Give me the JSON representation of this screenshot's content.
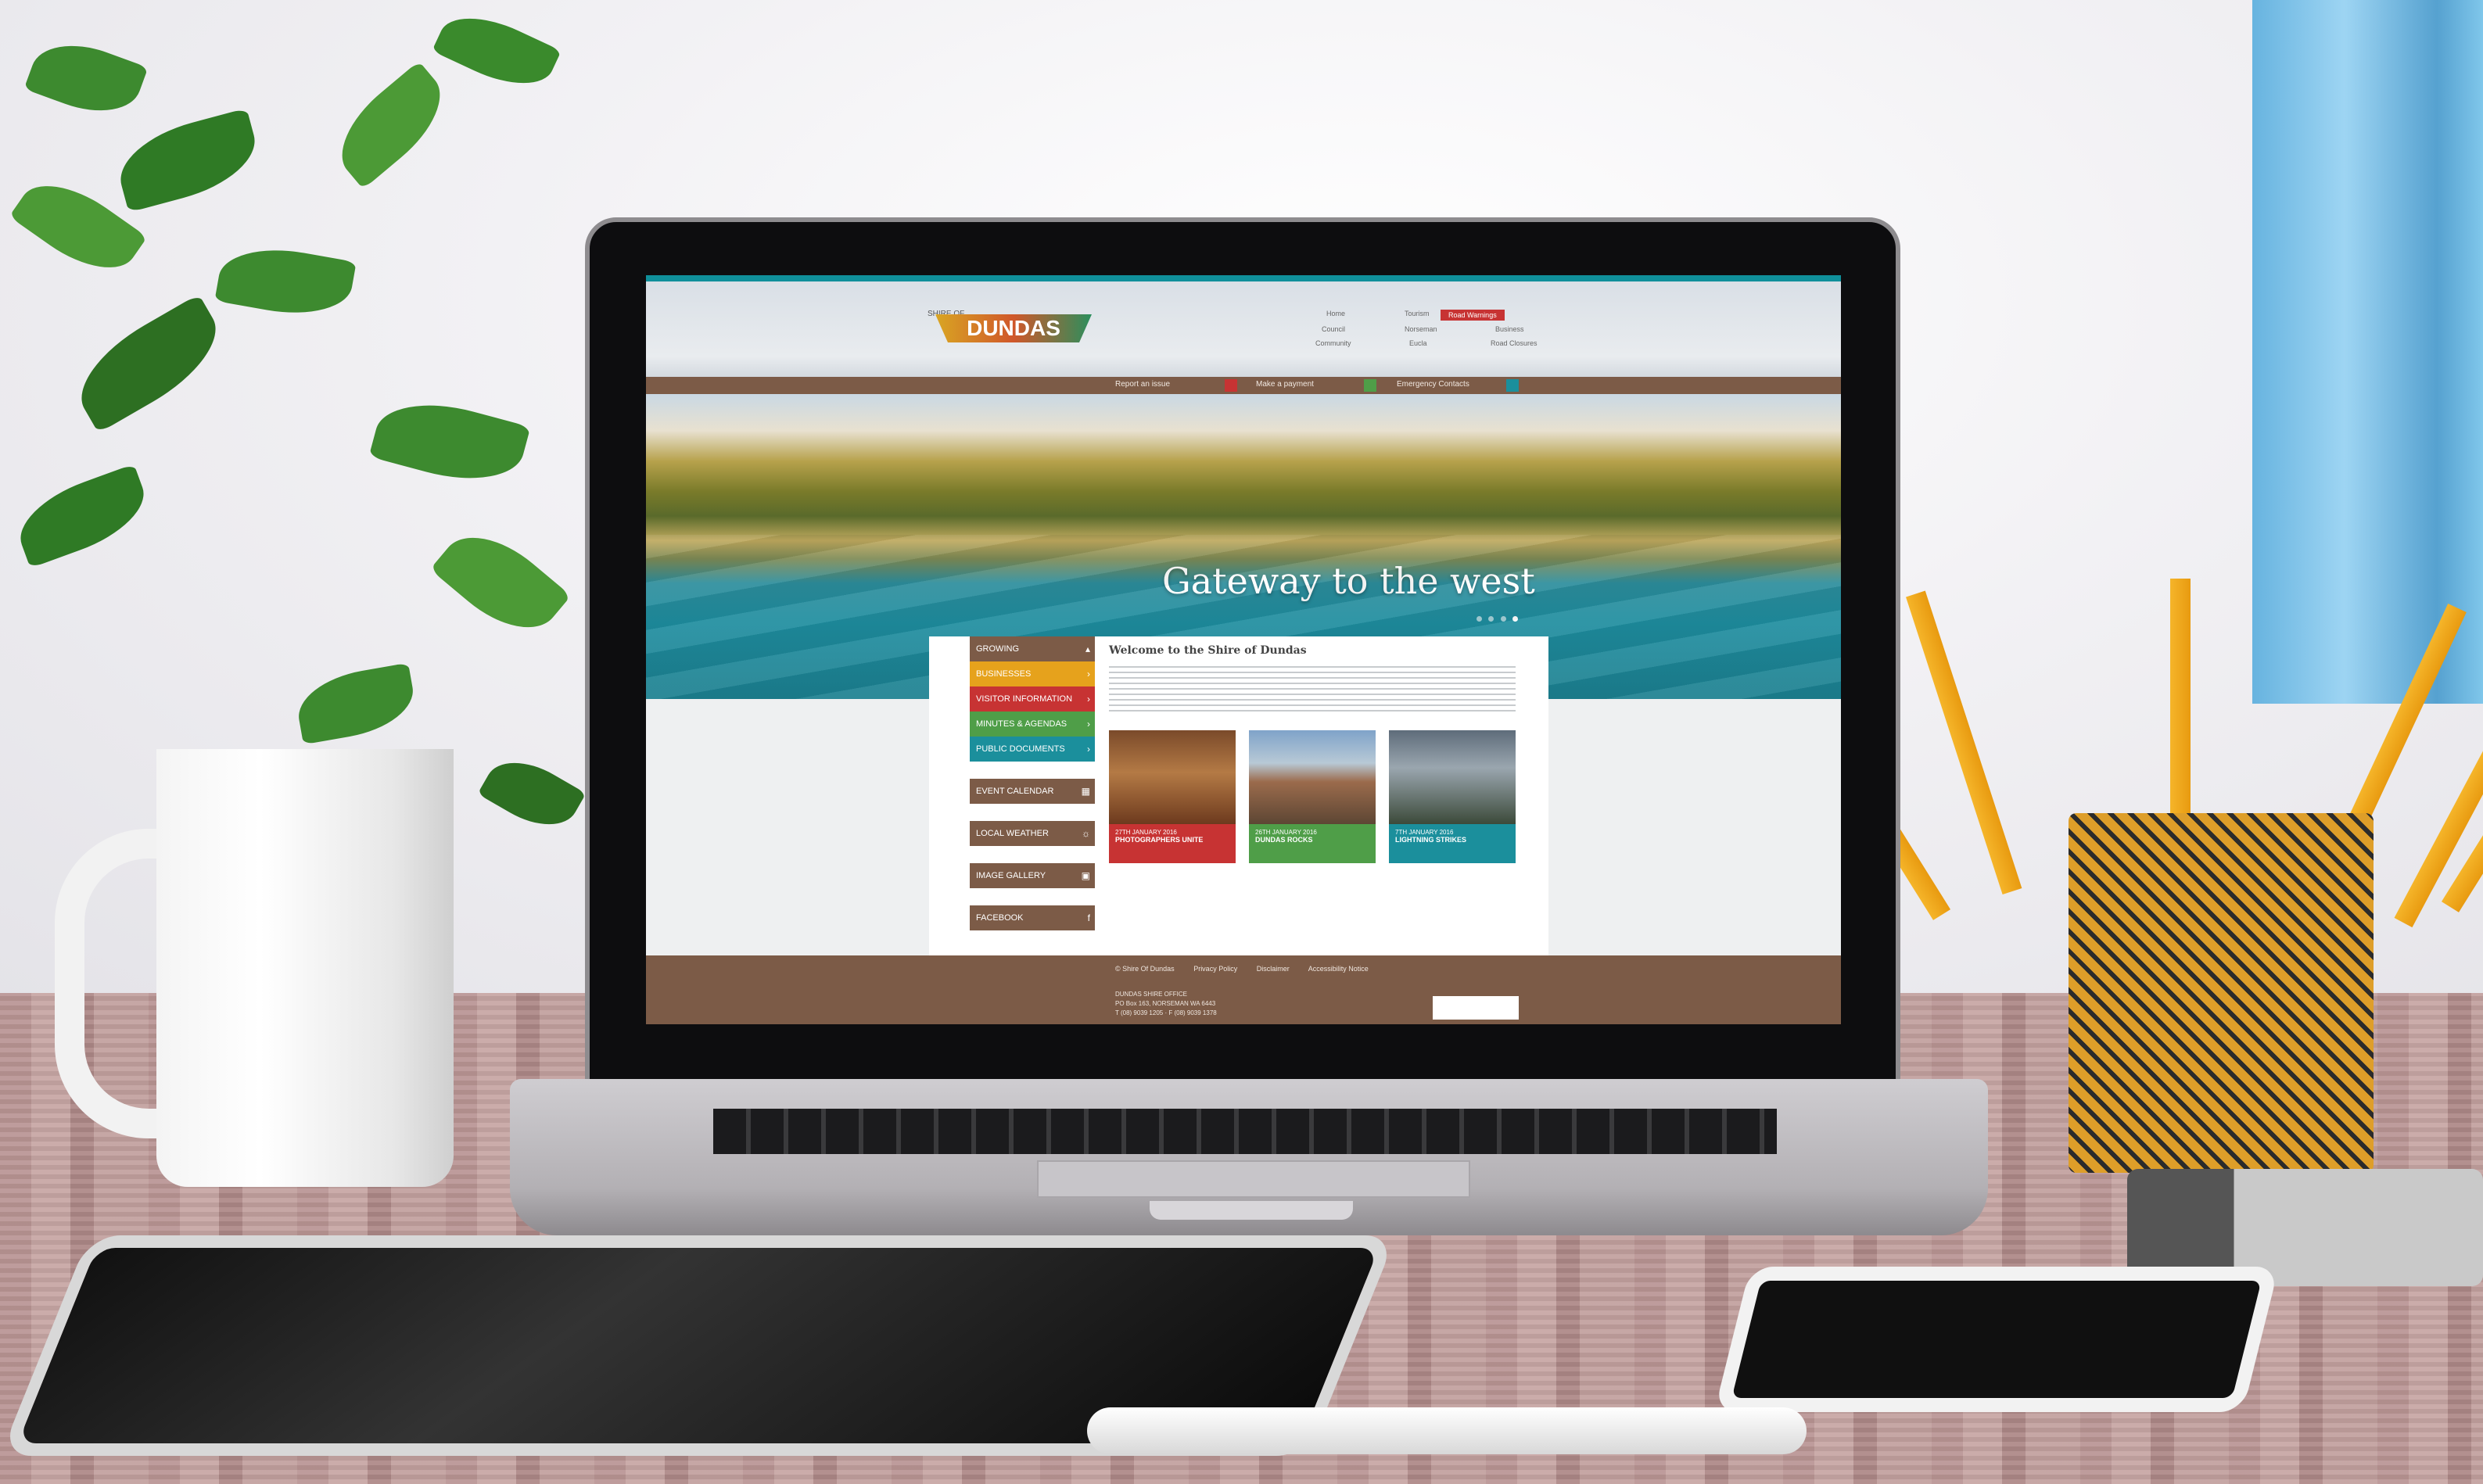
{
  "site": {
    "logo": {
      "top": "SHIRE OF",
      "name": "DUNDAS"
    },
    "topnav": [
      {
        "label": "Home"
      },
      {
        "label": "Council"
      },
      {
        "label": "Community"
      },
      {
        "label": "Tourism"
      },
      {
        "label": "Norseman"
      },
      {
        "label": "Eucla"
      },
      {
        "label": "Business"
      },
      {
        "label": "Road Closures"
      }
    ],
    "red_button": "Road Warnings",
    "subbar": [
      {
        "label": "Report an issue"
      },
      {
        "label": "Make a payment"
      },
      {
        "label": "Emergency Contacts"
      }
    ],
    "hero": {
      "title": "Gateway to the west",
      "dots": 4,
      "active_dot": 4
    },
    "sidebar": [
      {
        "label": "GROWING",
        "color": "#7c5b47"
      },
      {
        "label": "BUSINESSES",
        "color": "#e6a21c"
      },
      {
        "label": "VISITOR INFORMATION",
        "color": "#c73333"
      },
      {
        "label": "MINUTES & AGENDAS",
        "color": "#4f9e48"
      },
      {
        "label": "PUBLIC DOCUMENTS",
        "color": "#1b8f9c"
      }
    ],
    "sidebar_blocks": [
      {
        "label": "EVENT CALENDAR",
        "icon": "calendar-icon"
      },
      {
        "label": "LOCAL WEATHER",
        "icon": "weather-icon"
      },
      {
        "label": "IMAGE GALLERY",
        "icon": "image-icon"
      },
      {
        "label": "FACEBOOK",
        "icon": "facebook-icon"
      }
    ],
    "welcome_title": "Welcome to the Shire of Dundas",
    "cards": [
      {
        "date": "27TH JANUARY 2016",
        "title": "PHOTOGRAPHERS UNITE",
        "color": "#c73333"
      },
      {
        "date": "26TH JANUARY 2016",
        "title": "DUNDAS ROCKS",
        "color": "#4f9e48"
      },
      {
        "date": "7TH JANUARY 2016",
        "title": "LIGHTNING STRIKES",
        "color": "#1b8f9c"
      }
    ],
    "footer": {
      "links": [
        "© Shire Of Dundas",
        "Privacy Policy",
        "Disclaimer",
        "Accessibility Notice"
      ],
      "address_title": "DUNDAS SHIRE OFFICE",
      "address_line": "PO Box 163, NORSEMAN WA 6443",
      "contact_line": "T (08) 9039 1205 · F (08) 9039 1378"
    }
  },
  "colors": {
    "teal": "#1b8f9c",
    "brown": "#7c5b47",
    "red": "#c73333",
    "green": "#4f9e48",
    "yellow": "#e6a21c"
  }
}
